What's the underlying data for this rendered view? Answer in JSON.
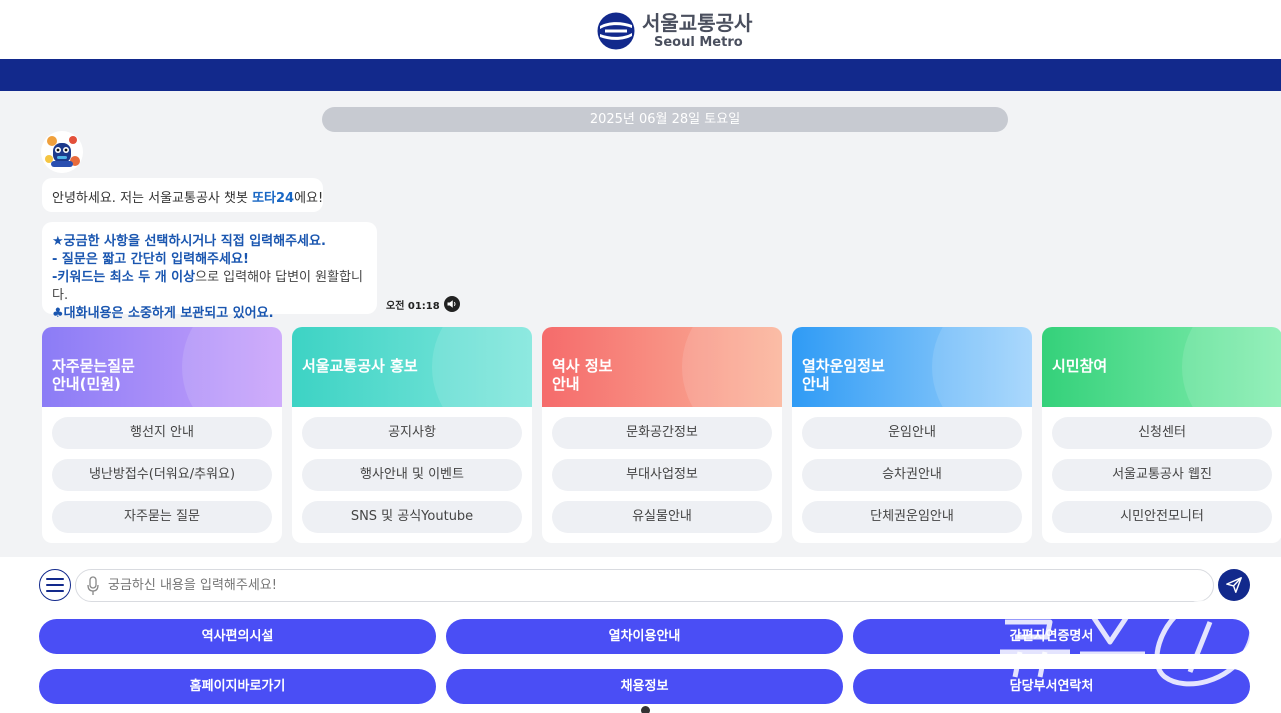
{
  "header": {
    "logo_kr": "서울교통공사",
    "logo_en": "Seoul Metro",
    "brand_color": "#12298c"
  },
  "chat": {
    "date": "2025년 06월 28일 토요일",
    "greeting_prefix": "안녕하세요. 저는 서울교통공사 챗봇 ",
    "greeting_name": "또타24",
    "greeting_suffix": "에요!",
    "notice_line1": "★궁금한 사항을 선택하시거나 직접 입력해주세요.",
    "notice_line2": "- 질문은 짧고 간단히 입력해주세요!",
    "notice_line3_bold": "-키워드는 최소 두 개 이상",
    "notice_line3_rest": "으로 입력해야 답변이 원활합니다.",
    "notice_line4": "♣대화내용은 소중하게 보관되고 있어요.",
    "time": "오전 01:18"
  },
  "cards": [
    {
      "title_line1": "자주묻는질문",
      "title_line2": "안내(민원)",
      "color_from": "#8b7cf6",
      "color_to": "#c9a2fb",
      "buttons": [
        "행선지 안내",
        "냉난방접수(더워요/추워요)",
        "자주묻는 질문"
      ]
    },
    {
      "title_line1": "서울교통공사 홍보",
      "title_line2": "",
      "color_from": "#3dd3c4",
      "color_to": "#7fe6dc",
      "buttons": [
        "공지사항",
        "행사안내 및 이벤트",
        "SNS 및 공식Youtube"
      ]
    },
    {
      "title_line1": "역사 정보",
      "title_line2": "안내",
      "color_from": "#f56b6b",
      "color_to": "#fbb49a",
      "buttons": [
        "문화공간정보",
        "부대사업정보",
        "유실물안내"
      ]
    },
    {
      "title_line1": "열차운임정보",
      "title_line2": "안내",
      "color_from": "#2f9bf5",
      "color_to": "#9fd3fc",
      "buttons": [
        "운임안내",
        "승차권안내",
        "단체권운임안내"
      ]
    },
    {
      "title_line1": "시민참여",
      "title_line2": "",
      "color_from": "#34d17a",
      "color_to": "#86eeb1",
      "buttons": [
        "신청센터",
        "서울교통공사 웹진",
        "시민안전모니터"
      ]
    }
  ],
  "input": {
    "placeholder": "궁금하신 내용을 입력해주세요!"
  },
  "quick_buttons": [
    "역사편의시설",
    "열차이용안내",
    "간편지연증명서",
    "홈페이지바로가기",
    "채용정보",
    "담당부서연락처"
  ],
  "watermark_text": "뉴스1"
}
